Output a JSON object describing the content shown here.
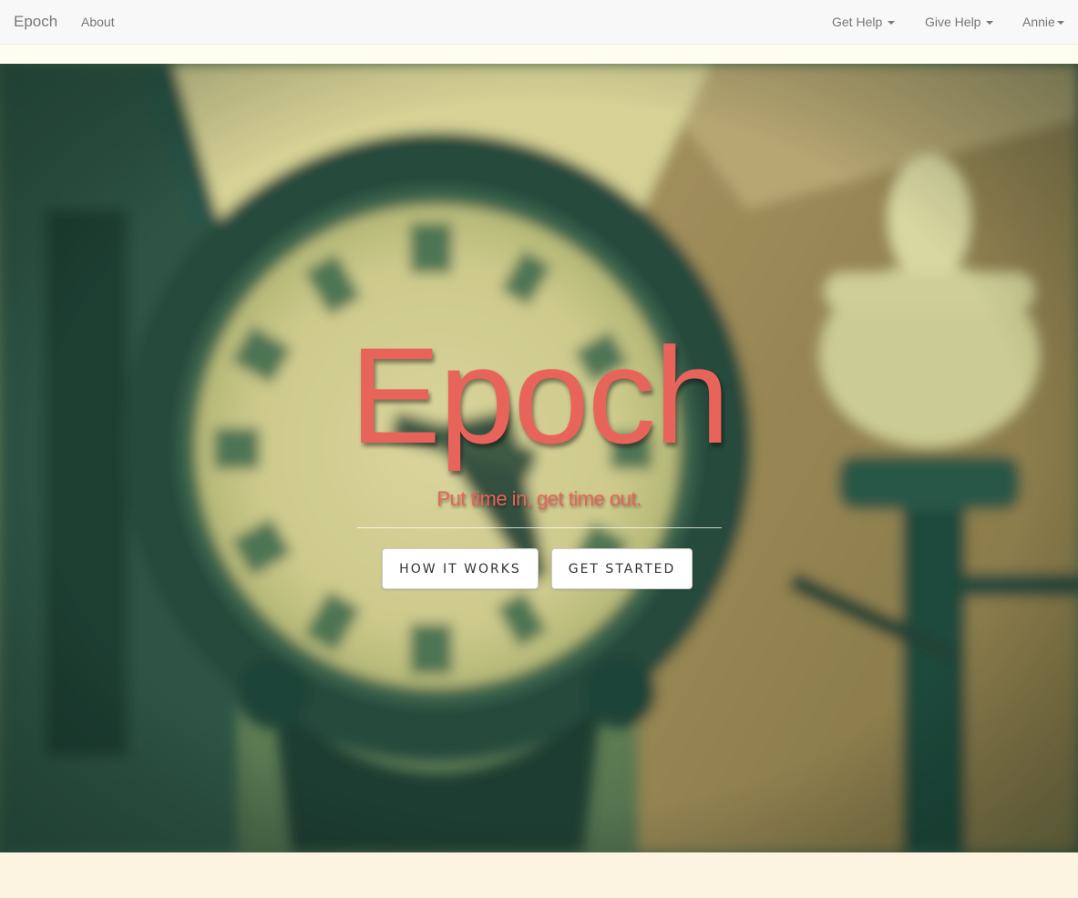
{
  "navbar": {
    "brand": "Epoch",
    "about": "About",
    "get_help": "Get Help",
    "give_help": "Give Help",
    "user": "Annie"
  },
  "hero": {
    "title": "Epoch",
    "tagline": "Put time in, get time out.",
    "how_it_works_label": "HOW IT WORKS",
    "get_started_label": "GET STARTED",
    "background_image": "blurred street clock and lamp post photo"
  },
  "colors": {
    "accent": "#e8645a",
    "navbar_bg": "#f8f8f8",
    "footer_bg": "#fcf4e1"
  }
}
